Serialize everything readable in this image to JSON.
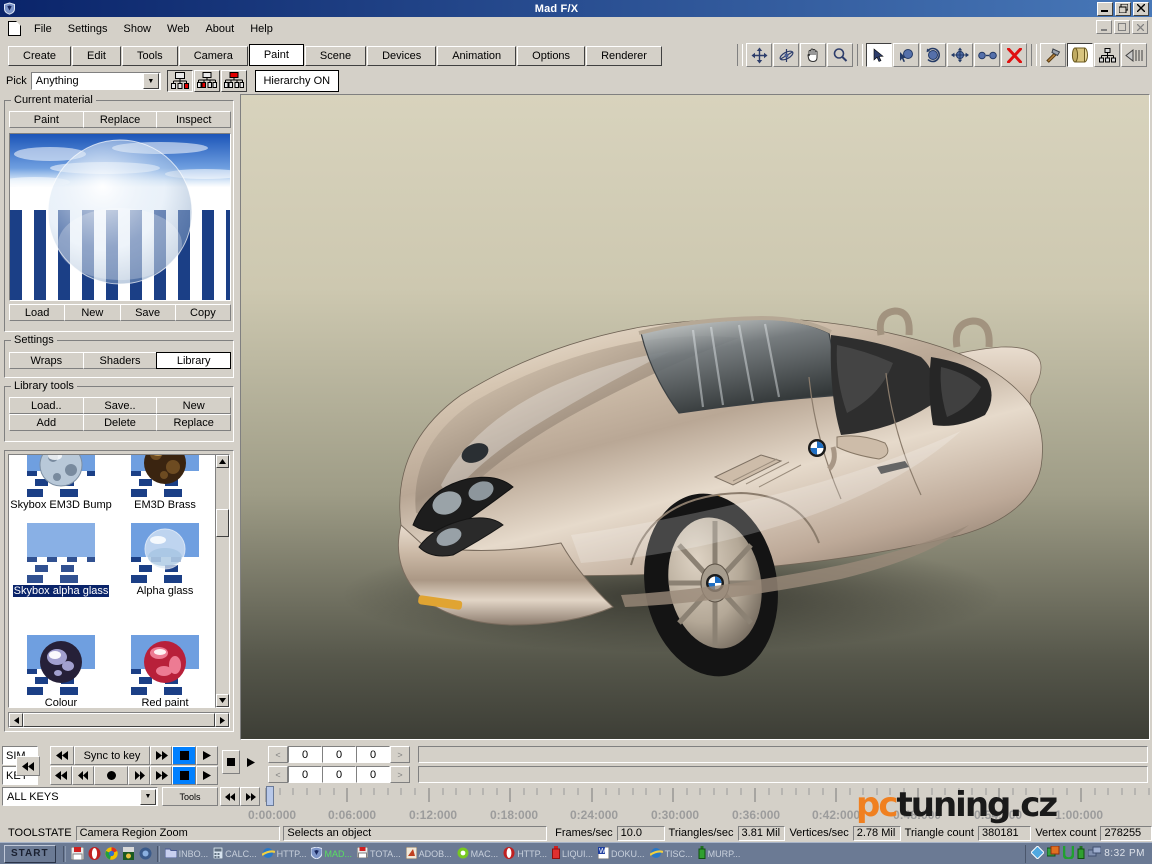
{
  "window": {
    "title": "Mad F/X",
    "icon": "app-shield-icon",
    "controls": [
      "minimize",
      "restore",
      "close"
    ],
    "mdi_controls": [
      "minimize",
      "restore",
      "close"
    ],
    "accent": "#0a246a"
  },
  "menu": {
    "items": [
      "File",
      "Settings",
      "Show",
      "Web",
      "About",
      "Help"
    ]
  },
  "tabs": {
    "items": [
      "Create",
      "Edit",
      "Tools",
      "Camera",
      "Paint",
      "Scene",
      "Devices",
      "Animation",
      "Options",
      "Renderer"
    ],
    "active": "Paint"
  },
  "toolbar": {
    "groups": [
      {
        "name": "nav",
        "icons": [
          "move-icon",
          "orbit-icon",
          "pan-hand-icon",
          "zoom-magnifier-icon"
        ]
      },
      {
        "name": "select",
        "icons": [
          "arrow-select-icon",
          "select-object-icon",
          "rotate-object-icon",
          "move-object-icon",
          "scale-object-icon",
          "delete-x-icon"
        ]
      },
      {
        "name": "tools",
        "icons": [
          "hammer-icon",
          "material-roll-icon",
          "hierarchy-icon",
          "collapse-arrow-icon"
        ]
      }
    ],
    "selected": "arrow-select-icon"
  },
  "pick_row": {
    "label": "Pick",
    "combo_value": "Anything",
    "combo_placeholder": "Anything",
    "hierarchy_icons": [
      "hierarchy-child-icon",
      "hierarchy-leaves-icon",
      "hierarchy-root-icon"
    ],
    "hierarchy_button": "Hierarchy ON"
  },
  "left_panel": {
    "current_material": {
      "legend": "Current material",
      "top_buttons": [
        "Paint",
        "Replace",
        "Inspect"
      ],
      "bottom_buttons": [
        "Load",
        "New",
        "Save",
        "Copy"
      ],
      "preview_alt": "checkered-floor-sky-sphere-preview"
    },
    "settings": {
      "legend": "Settings",
      "buttons": [
        "Wraps",
        "Shaders",
        "Library"
      ],
      "active": "Library"
    },
    "library_tools": {
      "legend": "Library tools",
      "row1": [
        "Load..",
        "Save..",
        "New"
      ],
      "row2": [
        "Add",
        "Delete",
        "Replace"
      ]
    },
    "library_items": [
      {
        "label": "Skybox EM3D Bump",
        "selected": false,
        "swatch": "mirror-ball"
      },
      {
        "label": "EM3D Brass",
        "selected": false,
        "swatch": "brass-ball"
      },
      {
        "label": "Skybox alpha glass",
        "selected": true,
        "swatch": "sky-plane"
      },
      {
        "label": "Alpha glass",
        "selected": false,
        "swatch": "glass-ball"
      },
      {
        "label": "Colour",
        "selected": false,
        "swatch": "violet-ball"
      },
      {
        "label": "Red paint",
        "selected": false,
        "swatch": "red-ball"
      }
    ]
  },
  "viewport": {
    "scene_alt": "BMW Z3 roadster champagne metallic 3D render",
    "background_top": "#d8d3bd",
    "background_bottom": "#3d3e36",
    "car_body_color": "#c9b9a5"
  },
  "animation_bar": {
    "sim_label": "SIM",
    "key_label": "KEY",
    "sync_button": "Sync to key",
    "keys_combo": "ALL KEYS",
    "tools_button": "Tools",
    "sim_transport": [
      "rewind-all-icon",
      "rewind-icon",
      "sync-to-key",
      "fast-forward-icon",
      "stop-icon",
      "play-icon"
    ],
    "key_transport": [
      "rewind-all-icon",
      "rewind-icon",
      "fast-back-icon",
      "record-icon",
      "fast-forward-icon",
      "forward-all-icon",
      "stop-icon",
      "play-icon"
    ],
    "extra_transport": [
      "stop-icon",
      "play-icon"
    ],
    "spinners_row1": [
      "0",
      "0",
      "0"
    ],
    "spinners_row2": [
      "0",
      "0",
      "0"
    ],
    "timeline_labels": [
      "0:00:000",
      "0:06:000",
      "0:12:000",
      "0:18:000",
      "0:24:000",
      "0:30:000",
      "0:36:000",
      "0:42:000",
      "0:48:000",
      "0:54:000",
      "1:00:000"
    ]
  },
  "status_bar": {
    "toolstate_label": "TOOLSTATE",
    "toolstate_value": "Camera Region Zoom",
    "hint": "Selects an object",
    "stats": [
      {
        "label": "Frames/sec",
        "value": "10.0"
      },
      {
        "label": "Triangles/sec",
        "value": "3.81 Mil"
      },
      {
        "label": "Vertices/sec",
        "value": "2.78 Mil"
      },
      {
        "label": "Triangle count",
        "value": "380181"
      },
      {
        "label": "Vertex count",
        "value": "278255"
      }
    ]
  },
  "watermark": {
    "part1": "pc",
    "part2": "tuning.cz",
    "color1": "#f08020",
    "color2": "#1a1a1a"
  },
  "taskbar": {
    "start_label": "START",
    "quick_icons": [
      "floppy-icon",
      "opera-icon",
      "chrome-icon",
      "winamp-icon",
      "o-icon"
    ],
    "tasks": [
      {
        "icon": "folder-icon",
        "label": "INBO..."
      },
      {
        "icon": "calc-icon",
        "label": "CALC..."
      },
      {
        "icon": "ie-icon",
        "label": "HTTP..."
      },
      {
        "icon": "madfx-icon",
        "label": "MAD..."
      },
      {
        "icon": "floppy-icon",
        "label": "TOTA..."
      },
      {
        "icon": "adobe-icon",
        "label": "ADOB..."
      },
      {
        "icon": "mac-icon",
        "label": "MAC..."
      },
      {
        "icon": "opera-icon",
        "label": "HTTP..."
      },
      {
        "icon": "liquid-icon",
        "label": "LIQUI..."
      },
      {
        "icon": "word-icon",
        "label": "DOKU..."
      },
      {
        "icon": "ie-icon",
        "label": "TISC..."
      },
      {
        "icon": "bottle-icon",
        "label": "MURP..."
      }
    ],
    "tray_icons": [
      "diamond-icon",
      "windows-icon",
      "u-icon",
      "bottle-icon",
      "network-icon"
    ],
    "clock": "8:32 PM"
  }
}
